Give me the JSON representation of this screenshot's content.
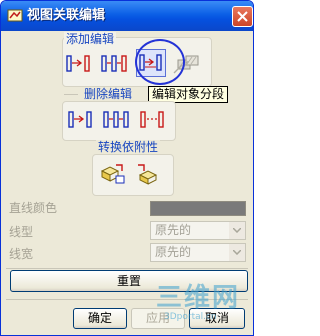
{
  "window": {
    "title": "视图关联编辑"
  },
  "add_group": {
    "title": "添加编辑"
  },
  "delete_group": {
    "title": "删除编辑"
  },
  "dependency_group": {
    "title": "转换依附性"
  },
  "tooltip": {
    "text": "编辑对象分段"
  },
  "properties": {
    "line_color_label": "直线颜色",
    "line_type_label": "线型",
    "line_type_value": "原先的",
    "line_width_label": "线宽",
    "line_width_value": "原先的"
  },
  "buttons": {
    "reset": "重置",
    "ok": "确定",
    "apply": "应用",
    "cancel": "取消"
  },
  "watermark": {
    "text": "三维网",
    "sub": "3Dportal.cn"
  },
  "colors": {
    "accent": "#1846c0",
    "selection_circle": "#2433d6",
    "red": "#d01818"
  }
}
